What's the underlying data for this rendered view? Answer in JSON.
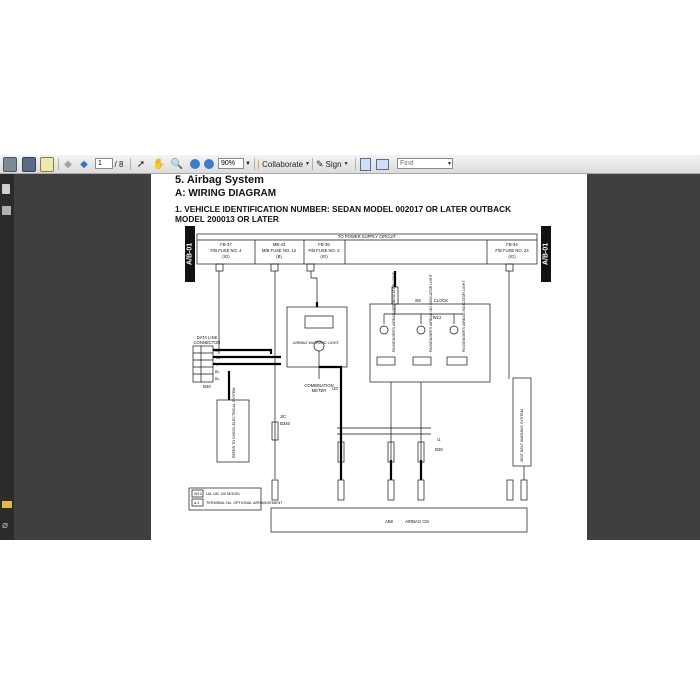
{
  "toolbar": {
    "page_current": "1",
    "page_total": "/ 8",
    "zoom": "90%",
    "collaborate_label": "Collaborate",
    "sign_label": "Sign",
    "find_placeholder": "Find"
  },
  "document": {
    "section_title": "5.  Airbag System",
    "subsection_title": "A:  WIRING DIAGRAM",
    "heading_line1": "1.  VEHICLE IDENTIFICATION NUMBER: SEDAN MODEL 002017 OR LATER    OUTBACK",
    "heading_line2": "MODEL 200013 OR LATER",
    "side_tab_left": "A/B-01",
    "side_tab_right": "A/B-01",
    "power_supply": "TO POWER SUPPLY CIRCUIT",
    "fuses": [
      {
        "line1": "FB-37",
        "line2": "F/B FUSE NO. 4",
        "line3": "(IG)"
      },
      {
        "line1": "MB-43",
        "line2": "M/B FUSE NO. 12",
        "line3": "(B)"
      },
      {
        "line1": "FB-36",
        "line2": "F/B FUSE NO. 3",
        "line3": "(IG)"
      },
      {
        "line1": "FB-34",
        "line2": "F/B FUSE NO. 23",
        "line3": "(IG)"
      }
    ],
    "clock_label": "CLOCK",
    "clock_conn": "i56",
    "data_link_label1": "DATA LINK",
    "data_link_label2": "CONNECTOR",
    "data_link_conn": "B40",
    "data_link_pins": [
      "GY",
      "YB",
      "Y",
      "BL",
      "BL"
    ],
    "diag_box_label": "REFER TO CHECK ELECTRICAL SYSTEM",
    "jc_label": "J/C",
    "jc_conn": "B346",
    "warning_light_1": "AIRBAG WARNING LIGHT",
    "warning_light_2": "PASSENGER'S AIRBAG OFF INDICATOR LIGHT",
    "warning_light_3": "PASSENGER'S AIRBAG ON INDICATOR LIGHT",
    "warning_light_4": "PASSENGER'S AIRBAG INDICATOR LIGHT",
    "combo_meter_label1": "COMBINATION",
    "combo_meter_label2": "METER",
    "combo_meter_conn": "i10",
    "w12_tag": "W12",
    "right_box_label": "SEAT BELT WARNING SYSTEM",
    "i1_tag": "i1",
    "b26_tag": "B26",
    "legend_1_tag": "W12",
    "legend_1_text": "UA, UB, UK MODEL",
    "legend_2_tag": "a-1",
    "legend_2_text": "TERMINAL No. OPTIONAL ARRANGEMENT",
    "airbag_cm_conn": "AB8",
    "airbag_cm_label": "AIRBAG CM"
  },
  "colors": {
    "toolbar_bg": "#e6e6e6",
    "viewer_bg": "#3f3f3f",
    "sidebar_bg": "#2b2b2b",
    "page_bg": "#ffffff"
  }
}
